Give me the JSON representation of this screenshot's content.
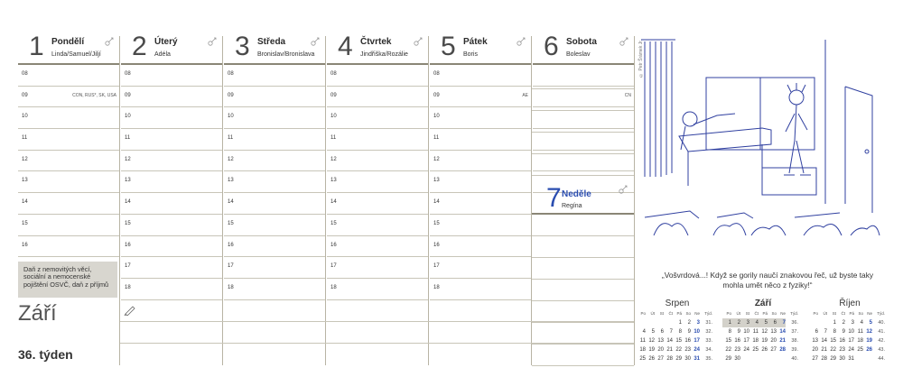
{
  "days": [
    {
      "num": "1",
      "name": "Pondělí",
      "saint": "Linda/Samuel/Jiljí",
      "hours": [
        "08",
        "09",
        "10",
        "11",
        "12",
        "13",
        "14",
        "15",
        "16"
      ],
      "note_hour": "09",
      "note": "CON, RUS*, SK, USA"
    },
    {
      "num": "2",
      "name": "Úterý",
      "saint": "Adéla",
      "hours": [
        "08",
        "09",
        "10",
        "11",
        "12",
        "13",
        "14",
        "15",
        "16",
        "17",
        "18"
      ],
      "note_hour": "",
      "note": ""
    },
    {
      "num": "3",
      "name": "Středa",
      "saint": "Bronislav/Bronislava",
      "hours": [
        "08",
        "09",
        "10",
        "11",
        "12",
        "13",
        "14",
        "15",
        "16",
        "17",
        "18"
      ],
      "note_hour": "",
      "note": ""
    },
    {
      "num": "4",
      "name": "Čtvrtek",
      "saint": "Jindřiška/Rozálie",
      "hours": [
        "08",
        "09",
        "10",
        "11",
        "12",
        "13",
        "14",
        "15",
        "16",
        "17",
        "18"
      ],
      "note_hour": "",
      "note": ""
    },
    {
      "num": "5",
      "name": "Pátek",
      "saint": "Boris",
      "hours": [
        "08",
        "09",
        "10",
        "11",
        "12",
        "13",
        "14",
        "15",
        "16",
        "17",
        "18"
      ],
      "note_hour": "09",
      "note": "AE"
    },
    {
      "num": "6",
      "name": "Sobota",
      "saint": "Boleslav",
      "hours": [
        "",
        "",
        "",
        "",
        "",
        ""
      ],
      "note_hour": "09",
      "note": "CN"
    }
  ],
  "sunday": {
    "num": "7",
    "name": "Neděle",
    "saint": "Regína"
  },
  "tax_note": "Daň z nemovitých věcí, sociální a nemocenské pojištění OSVČ, daň z příjmů",
  "month": "Září",
  "week": "36. týden",
  "credit": "© Petr Šrámek Jr.",
  "caption": "„Vošvrdová...! Když se gorily naučí znakovou řeč, už byste taky mohla umět něco z fyziky!“",
  "mini_calendars": [
    {
      "title": "Srpen",
      "bold": false,
      "headers": [
        "Po",
        "Út",
        "St",
        "Čt",
        "Pá",
        "So",
        "Ne",
        "Týd."
      ],
      "rows": [
        [
          "",
          "",
          "",
          "",
          "1",
          "2",
          "3",
          "31."
        ],
        [
          "4",
          "5",
          "6",
          "7",
          "8",
          "9",
          "10",
          "32."
        ],
        [
          "11",
          "12",
          "13",
          "14",
          "15",
          "16",
          "17",
          "33."
        ],
        [
          "18",
          "19",
          "20",
          "21",
          "22",
          "23",
          "24",
          "34."
        ],
        [
          "25",
          "26",
          "27",
          "28",
          "29",
          "30",
          "31",
          "35."
        ]
      ]
    },
    {
      "title": "Září",
      "bold": true,
      "headers": [
        "Po",
        "Út",
        "St",
        "Čt",
        "Pá",
        "So",
        "Ne",
        "Týd."
      ],
      "rows": [
        [
          "1",
          "2",
          "3",
          "4",
          "5",
          "6",
          "7",
          "36."
        ],
        [
          "8",
          "9",
          "10",
          "11",
          "12",
          "13",
          "14",
          "37."
        ],
        [
          "15",
          "16",
          "17",
          "18",
          "19",
          "20",
          "21",
          "38."
        ],
        [
          "22",
          "23",
          "24",
          "25",
          "26",
          "27",
          "28",
          "39."
        ],
        [
          "29",
          "30",
          "",
          "",
          "",
          "",
          "",
          "40."
        ]
      ]
    },
    {
      "title": "Říjen",
      "bold": false,
      "headers": [
        "Po",
        "Út",
        "St",
        "Čt",
        "Pá",
        "So",
        "Ne",
        "Týd."
      ],
      "rows": [
        [
          "",
          "",
          "1",
          "2",
          "3",
          "4",
          "5",
          "40."
        ],
        [
          "6",
          "7",
          "8",
          "9",
          "10",
          "11",
          "12",
          "41."
        ],
        [
          "13",
          "14",
          "15",
          "16",
          "17",
          "18",
          "19",
          "42."
        ],
        [
          "20",
          "21",
          "22",
          "23",
          "24",
          "25",
          "26",
          "43."
        ],
        [
          "27",
          "28",
          "29",
          "30",
          "31",
          "",
          "",
          "44."
        ]
      ]
    }
  ],
  "colors": {
    "accent": "#2a4db0",
    "rule": "#8a8676",
    "tax_bg": "#d8d6cf"
  },
  "icons": [
    "zodiac-icon",
    "pencil-icon"
  ]
}
